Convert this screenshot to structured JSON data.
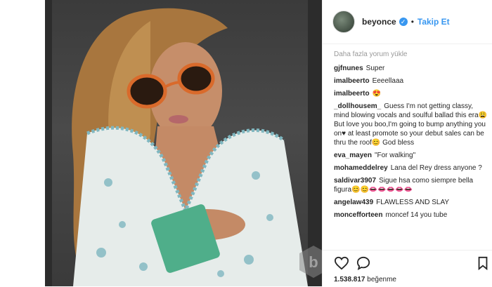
{
  "header": {
    "username": "beyonce",
    "separator": "•",
    "follow_label": "Takip Et",
    "verified_glyph": "✓"
  },
  "comments": {
    "load_more": "Daha fazla yorum yükle",
    "items": [
      {
        "user": "gjfnunes",
        "text": "Super"
      },
      {
        "user": "imalbeerto",
        "text": "Eeeellaaa"
      },
      {
        "user": "imalbeerto",
        "text": "😍"
      },
      {
        "user": "_dollhousem_",
        "text": "Guess I'm not getting classy, mind blowing vocals and soulful ballad this era😩 But love you boo,I'm going to bump anything you on♥ at least promote so your debut sales can be thru the roof😊 God bless"
      },
      {
        "user": "eva_mayen",
        "text": "\"For walking\""
      },
      {
        "user": "mohameddelrey",
        "text": "Lana del Rey dress anyone ?"
      },
      {
        "user": "saldivar3907",
        "text": "Sigue hsa como siempre bella figura😊😊👄👄👄👄👄"
      },
      {
        "user": "angelaw439",
        "text": "FLAWLESS AND SLAY"
      },
      {
        "user": "moncefforteen",
        "text": "moncef 14 you tube"
      }
    ]
  },
  "actions": {
    "like_icon": "heart-icon",
    "comment_icon": "comment-icon",
    "save_icon": "bookmark-icon",
    "likes_count": "1.538.817",
    "likes_label": "beğenme"
  },
  "colors": {
    "accent": "#3897f0",
    "text": "#262626",
    "muted": "#999999"
  }
}
